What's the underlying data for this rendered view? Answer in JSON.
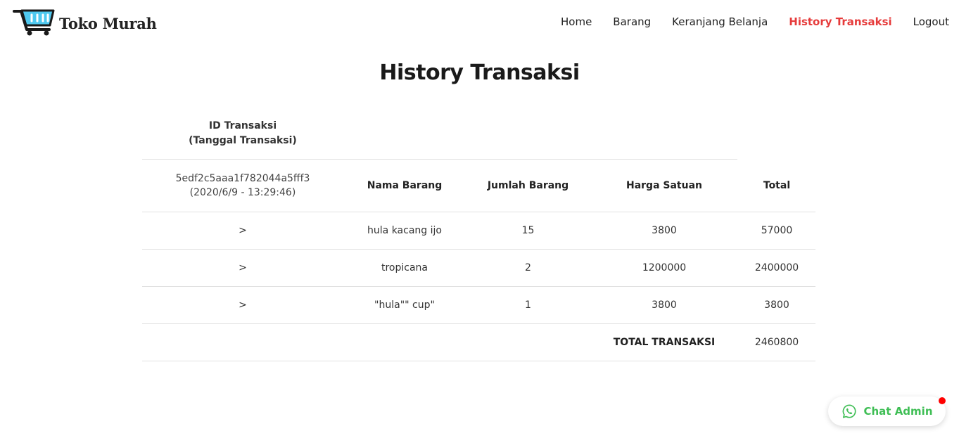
{
  "brand": {
    "name": "Toko Murah",
    "icon": "shopping-cart-icon",
    "icon_color": "#4fc9f0"
  },
  "nav": {
    "items": [
      {
        "label": "Home"
      },
      {
        "label": "Barang"
      },
      {
        "label": "Keranjang Belanja"
      },
      {
        "label": "History Transaksi"
      },
      {
        "label": "Logout"
      }
    ],
    "active": "History Transaksi",
    "active_color": "#e63b3b"
  },
  "page": {
    "title": "History Transaksi"
  },
  "table": {
    "id_header_line1": "ID Transaksi",
    "id_header_line2": "(Tanggal Transaksi)",
    "transaction": {
      "id": "5edf2c5aaa1f782044a5fff3",
      "date": "(2020/6/9 - 13:29:46)"
    },
    "columns": [
      "Nama Barang",
      "Jumlah Barang",
      "Harga Satuan",
      "Total"
    ],
    "items": [
      {
        "marker": ">",
        "nama": "hula kacang ijo",
        "jumlah": "15",
        "harga": "3800",
        "total": "57000"
      },
      {
        "marker": ">",
        "nama": "tropicana",
        "jumlah": "2",
        "harga": "1200000",
        "total": "2400000"
      },
      {
        "marker": ">",
        "nama": "\"hula\"\" cup\"",
        "jumlah": "1",
        "harga": "3800",
        "total": "3800"
      }
    ],
    "total_label": "TOTAL TRANSAKSI",
    "total_value": "2460800"
  },
  "chat": {
    "label": "Chat Admin",
    "icon": "whatsapp-icon",
    "color": "#3fbe55",
    "badge_color": "#ff0000"
  }
}
